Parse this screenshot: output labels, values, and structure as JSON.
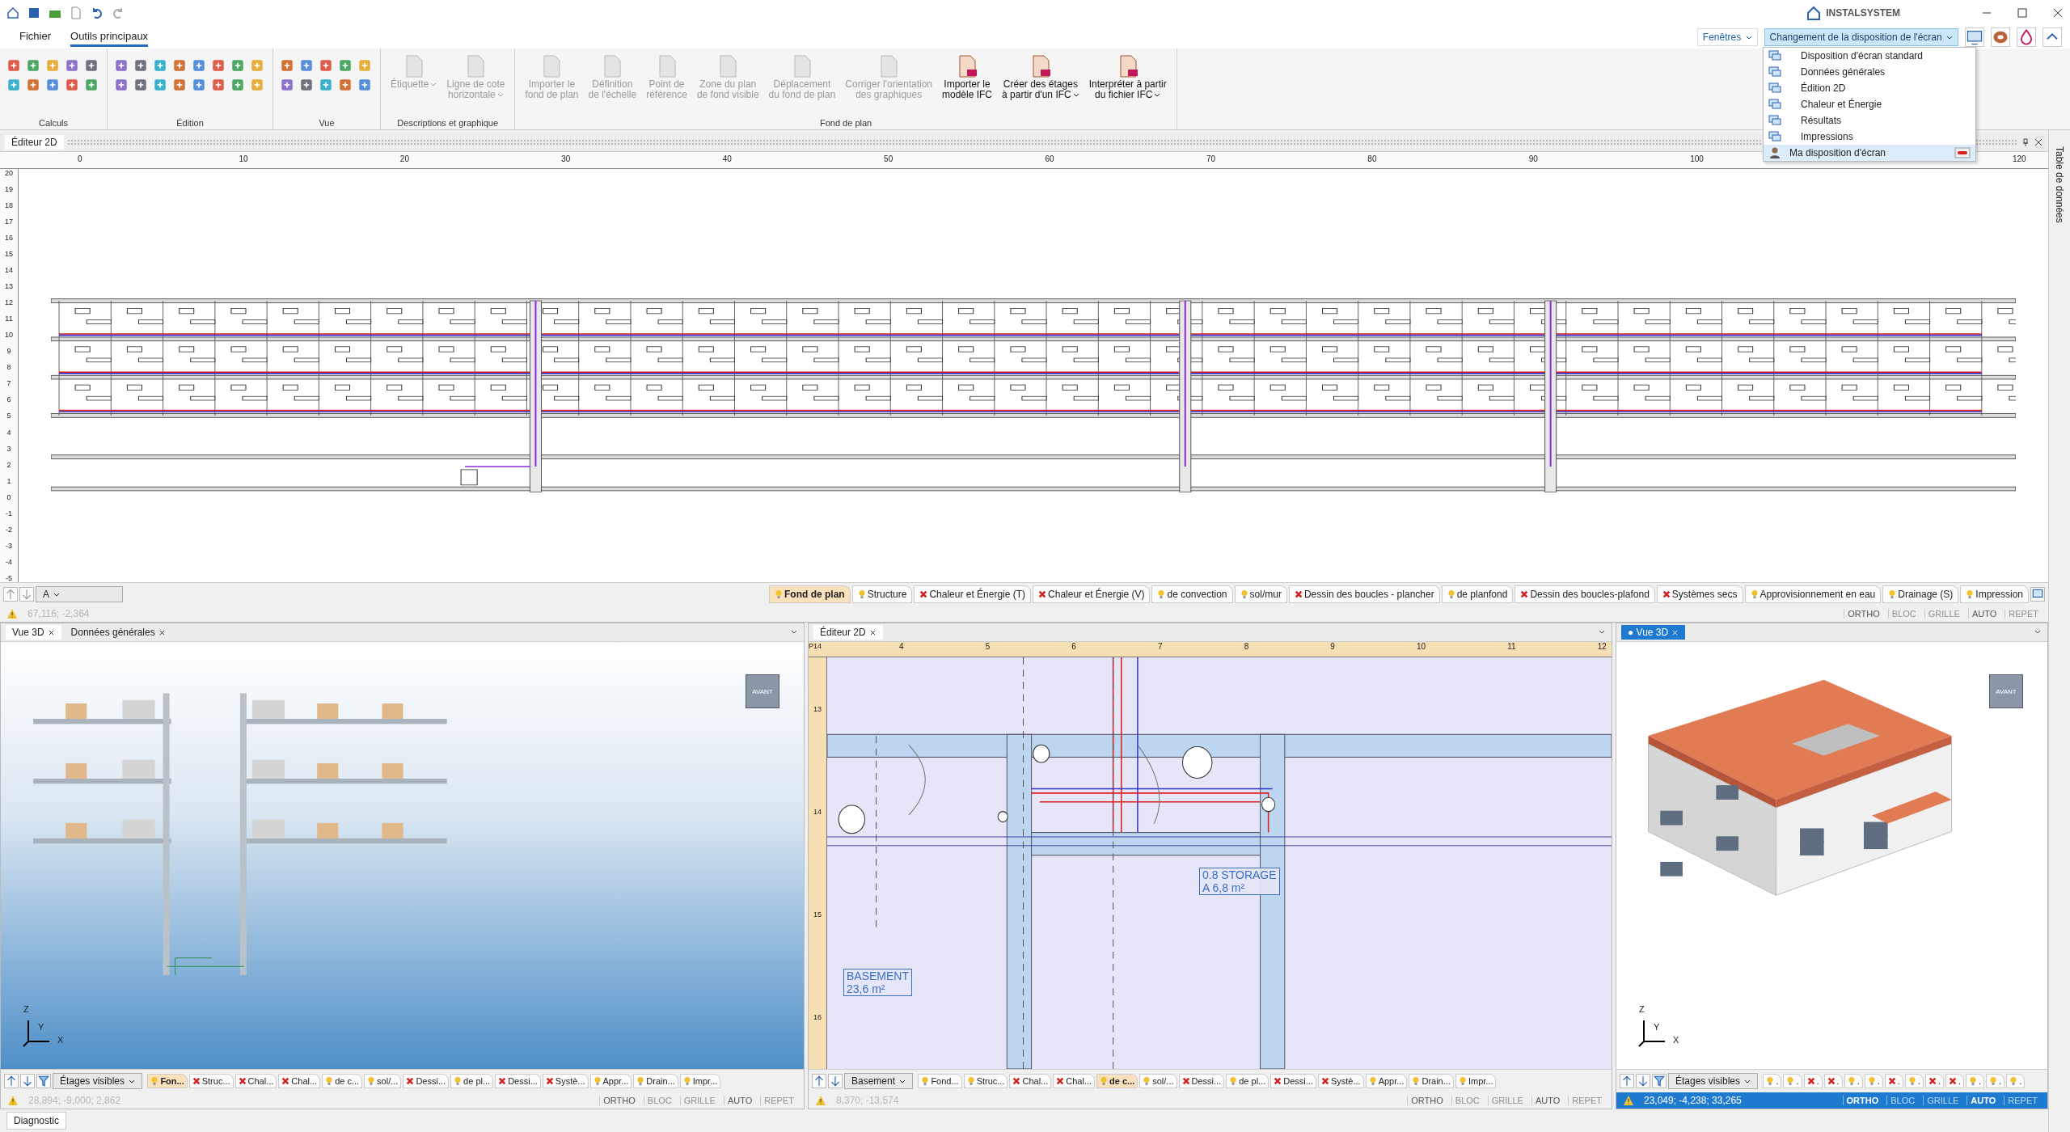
{
  "title_bar": {
    "logo": "INSTALSYSTEM"
  },
  "menu_tabs": [
    {
      "label": "Fichier",
      "selected": false
    },
    {
      "label": "Outils principaux",
      "selected": true
    }
  ],
  "ribbon": {
    "groups": [
      {
        "label": "Calculs",
        "kind": "icons"
      },
      {
        "label": "Édition",
        "kind": "icons"
      },
      {
        "label": "Vue",
        "kind": "icons"
      },
      {
        "label": "Descriptions et graphique",
        "kind": "buttons",
        "buttons": [
          {
            "label": "Étiquette",
            "dropdown": true,
            "disabled": true
          },
          {
            "label": "Ligne de cote\nhorizontale",
            "dropdown": true,
            "disabled": true
          }
        ]
      },
      {
        "label": "Fond de plan",
        "kind": "buttons",
        "buttons": [
          {
            "label": "Importer le\nfond de plan",
            "dropdown": false,
            "disabled": true
          },
          {
            "label": "Définition\nde l'échelle",
            "dropdown": false,
            "disabled": true
          },
          {
            "label": "Point de\nréférence",
            "dropdown": false,
            "disabled": true
          },
          {
            "label": "Zone du plan\nde fond visible",
            "dropdown": false,
            "disabled": true
          },
          {
            "label": "Déplacement\ndu fond de plan",
            "dropdown": false,
            "disabled": true
          },
          {
            "label": "Corriger l'orientation\ndes graphiques",
            "dropdown": false,
            "disabled": true
          },
          {
            "label": "Importer le\nmodèle IFC",
            "dropdown": false,
            "disabled": false
          },
          {
            "label": "Créer des étages\nà partir d'un IFC",
            "dropdown": true,
            "disabled": false
          },
          {
            "label": "Interpréter à partir\ndu fichier IFC",
            "dropdown": true,
            "disabled": false
          }
        ]
      }
    ]
  },
  "layout_bar": {
    "windows_button": "Fenêtres",
    "layout_button": "Changement de la disposition de l'écran",
    "menu_open": true,
    "menu_items": [
      {
        "label": "Disposition d'écran standard",
        "kind": "preset",
        "selected": false
      },
      {
        "label": "Données générales",
        "kind": "preset",
        "selected": false
      },
      {
        "label": "Édition 2D",
        "kind": "preset",
        "selected": false
      },
      {
        "label": "Chaleur et Énergie",
        "kind": "preset",
        "selected": false
      },
      {
        "label": "Résultats",
        "kind": "preset",
        "selected": false
      },
      {
        "label": "Impressions",
        "kind": "preset",
        "selected": false
      },
      {
        "label": "Ma disposition d'écran",
        "kind": "custom",
        "selected": true
      }
    ]
  },
  "side_panel": {
    "label": "Table de données"
  },
  "top_editor": {
    "tab": "Éditeur 2D",
    "x_ruler": [
      "0",
      "10",
      "20",
      "30",
      "40",
      "50",
      "60",
      "70",
      "80",
      "90",
      "100",
      "120"
    ],
    "y_ruler": [
      "20",
      "19",
      "18",
      "17",
      "16",
      "15",
      "14",
      "13",
      "12",
      "11",
      "10",
      "9",
      "8",
      "7",
      "6",
      "5",
      "4",
      "3",
      "2",
      "1",
      "0",
      "-1",
      "-2",
      "-3",
      "-4",
      "-5"
    ],
    "level_select": "A",
    "layers": [
      {
        "label": "Fond de plan",
        "visible": true,
        "selected": true
      },
      {
        "label": "Structure",
        "visible": true,
        "selected": false
      },
      {
        "label": "Chaleur et Énergie (T)",
        "visible": false,
        "selected": false
      },
      {
        "label": "Chaleur et Énergie (V)",
        "visible": false,
        "selected": false
      },
      {
        "label": "de convection",
        "visible": true,
        "selected": false
      },
      {
        "label": "sol/mur",
        "visible": true,
        "selected": false
      },
      {
        "label": "Dessin des boucles - plancher",
        "visible": false,
        "selected": false
      },
      {
        "label": "de planfond",
        "visible": true,
        "selected": false
      },
      {
        "label": "Dessin des boucles-plafond",
        "visible": false,
        "selected": false
      },
      {
        "label": "Systèmes secs",
        "visible": false,
        "selected": false
      },
      {
        "label": "Approvisionnement en eau",
        "visible": true,
        "selected": false
      },
      {
        "label": "Drainage (S)",
        "visible": true,
        "selected": false
      },
      {
        "label": "Impression",
        "visible": true,
        "selected": false
      }
    ],
    "status": {
      "active": false,
      "coordinates": "67,116; -2,364",
      "toggles": [
        {
          "label": "ORTHO",
          "on": true
        },
        {
          "label": "BLOC",
          "on": false
        },
        {
          "label": "GRILLE",
          "on": false
        },
        {
          "label": "AUTO",
          "on": true
        },
        {
          "label": "REPET",
          "on": false
        }
      ]
    }
  },
  "bottom_panels": [
    {
      "kind": "section-3d",
      "tabs": [
        {
          "label": "Vue 3D",
          "selected": true
        },
        {
          "label": "Données générales",
          "selected": false
        }
      ],
      "view_cube": "AVANT",
      "axes": [
        "Z",
        "Y",
        "X"
      ],
      "level_select": "Étages visibles",
      "layers": [
        {
          "label": "Fon...",
          "visible": true,
          "selected": true
        },
        {
          "label": "Struc...",
          "visible": false,
          "selected": false
        },
        {
          "label": "Chal...",
          "visible": false,
          "selected": false
        },
        {
          "label": "Chal...",
          "visible": false,
          "selected": false
        },
        {
          "label": "de c...",
          "visible": true,
          "selected": false
        },
        {
          "label": "sol/...",
          "visible": true,
          "selected": false
        },
        {
          "label": "Dessi...",
          "visible": false,
          "selected": false
        },
        {
          "label": "de pl...",
          "visible": true,
          "selected": false
        },
        {
          "label": "Dessi...",
          "visible": false,
          "selected": false
        },
        {
          "label": "Systè...",
          "visible": false,
          "selected": false
        },
        {
          "label": "Appr...",
          "visible": true,
          "selected": false
        },
        {
          "label": "Drain...",
          "visible": true,
          "selected": false
        },
        {
          "label": "Impr...",
          "visible": true,
          "selected": false
        }
      ],
      "status": {
        "active": false,
        "coordinates": "28,894; -9,000; 2,862",
        "toggles": [
          {
            "label": "ORTHO",
            "on": true
          },
          {
            "label": "BLOC",
            "on": false
          },
          {
            "label": "GRILLE",
            "on": false
          },
          {
            "label": "AUTO",
            "on": true
          },
          {
            "label": "REPET",
            "on": false
          }
        ]
      }
    },
    {
      "kind": "plan",
      "tabs": [
        {
          "label": "Éditeur 2D",
          "selected": true
        }
      ],
      "corner_label": "P14",
      "x_ruler": [
        "4",
        "5",
        "6",
        "7",
        "8",
        "9",
        "10",
        "11",
        "12"
      ],
      "y_ruler": [
        "13",
        "14",
        "15",
        "16"
      ],
      "rooms": [
        {
          "name": "BASEMENT",
          "area": "23,6 m²"
        },
        {
          "name": "STORAGE",
          "area": "6,8 m²",
          "code": "A",
          "number": "0.8"
        }
      ],
      "level_select": "Basement",
      "layers": [
        {
          "label": "Fond...",
          "visible": true,
          "selected": false
        },
        {
          "label": "Struc...",
          "visible": true,
          "selected": false
        },
        {
          "label": "Chal...",
          "visible": false,
          "selected": false
        },
        {
          "label": "Chal...",
          "visible": false,
          "selected": false
        },
        {
          "label": "de c...",
          "visible": true,
          "selected": true
        },
        {
          "label": "sol/...",
          "visible": true,
          "selected": false
        },
        {
          "label": "Dessi...",
          "visible": false,
          "selected": false
        },
        {
          "label": "de pl...",
          "visible": true,
          "selected": false
        },
        {
          "label": "Dessi...",
          "visible": false,
          "selected": false
        },
        {
          "label": "Systè...",
          "visible": false,
          "selected": false
        },
        {
          "label": "Appr...",
          "visible": true,
          "selected": false
        },
        {
          "label": "Drain...",
          "visible": true,
          "selected": false
        },
        {
          "label": "Impr...",
          "visible": true,
          "selected": false
        }
      ],
      "status": {
        "active": false,
        "coordinates": "8,370; -13,574",
        "toggles": [
          {
            "label": "ORTHO",
            "on": true
          },
          {
            "label": "BLOC",
            "on": false
          },
          {
            "label": "GRILLE",
            "on": false
          },
          {
            "label": "AUTO",
            "on": true
          },
          {
            "label": "REPET",
            "on": false
          }
        ]
      }
    },
    {
      "kind": "building-3d",
      "tabs": [
        {
          "label": "● Vue 3D",
          "selected": true
        }
      ],
      "view_cube": "AVANT",
      "axes": [
        "Z",
        "Y",
        "X"
      ],
      "level_select": "Étages visibles",
      "layers": [
        {
          "label": ".",
          "visible": true,
          "selected": false
        },
        {
          "label": ".",
          "visible": true,
          "selected": false
        },
        {
          "label": ".",
          "visible": false,
          "selected": false
        },
        {
          "label": ".",
          "visible": false,
          "selected": false
        },
        {
          "label": ".",
          "visible": true,
          "selected": false
        },
        {
          "label": ".",
          "visible": true,
          "selected": false
        },
        {
          "label": ".",
          "visible": false,
          "selected": false
        },
        {
          "label": ".",
          "visible": true,
          "selected": false
        },
        {
          "label": ".",
          "visible": false,
          "selected": false
        },
        {
          "label": ".",
          "visible": false,
          "selected": false
        },
        {
          "label": ".",
          "visible": true,
          "selected": false
        },
        {
          "label": ".",
          "visible": true,
          "selected": false
        },
        {
          "label": ".",
          "visible": true,
          "selected": false
        }
      ],
      "status": {
        "active": true,
        "coordinates": "23,049; -4,238; 33,265",
        "toggles": [
          {
            "label": "ORTHO",
            "on": true
          },
          {
            "label": "BLOC",
            "on": false
          },
          {
            "label": "GRILLE",
            "on": false
          },
          {
            "label": "AUTO",
            "on": true
          },
          {
            "label": "REPET",
            "on": false
          }
        ]
      }
    }
  ],
  "diagnostic_tab": "Diagnostic"
}
